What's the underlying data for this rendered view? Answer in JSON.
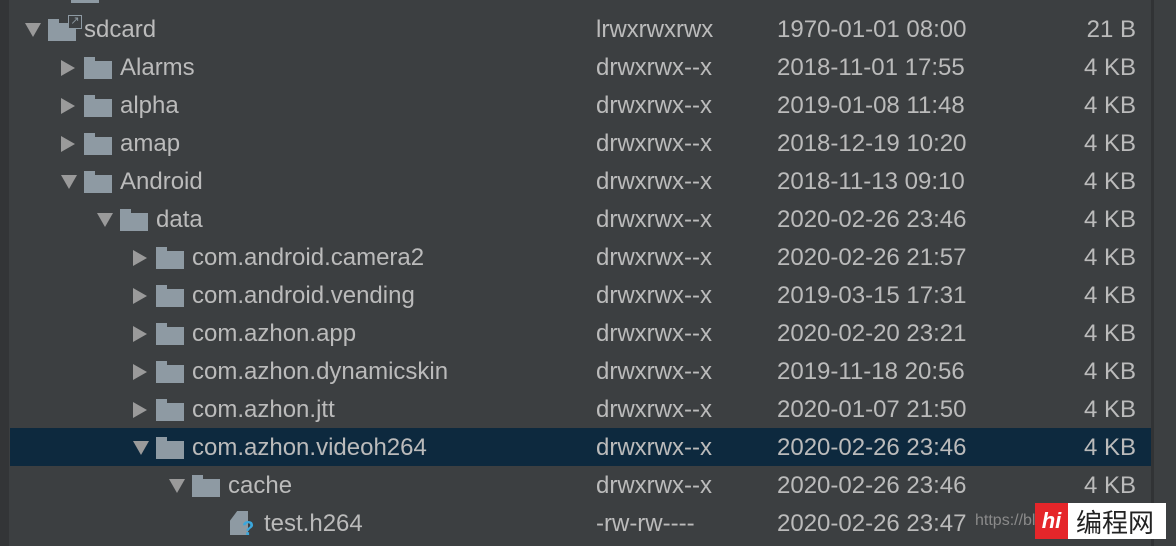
{
  "colors": {
    "background": "#3c3f41",
    "selected": "#0d293e",
    "text": "#bbbbbb",
    "folder": "#8e9aa3",
    "unknown_file": "#3ba7dc"
  },
  "rows": [
    {
      "name": "",
      "perm": "",
      "date": "",
      "size": "",
      "level": 0,
      "type": "folder",
      "arrow": "none"
    },
    {
      "name": "sdcard",
      "perm": "lrwxrwxrwx",
      "date": "1970-01-01 08:00",
      "size": "21 B",
      "level": 0,
      "type": "link",
      "arrow": "down"
    },
    {
      "name": "Alarms",
      "perm": "drwxrwx--x",
      "date": "2018-11-01 17:55",
      "size": "4 KB",
      "level": 1,
      "type": "folder",
      "arrow": "right"
    },
    {
      "name": "alpha",
      "perm": "drwxrwx--x",
      "date": "2019-01-08 11:48",
      "size": "4 KB",
      "level": 1,
      "type": "folder",
      "arrow": "right"
    },
    {
      "name": "amap",
      "perm": "drwxrwx--x",
      "date": "2018-12-19 10:20",
      "size": "4 KB",
      "level": 1,
      "type": "folder",
      "arrow": "right"
    },
    {
      "name": "Android",
      "perm": "drwxrwx--x",
      "date": "2018-11-13 09:10",
      "size": "4 KB",
      "level": 1,
      "type": "folder",
      "arrow": "down"
    },
    {
      "name": "data",
      "perm": "drwxrwx--x",
      "date": "2020-02-26 23:46",
      "size": "4 KB",
      "level": 2,
      "type": "folder",
      "arrow": "down"
    },
    {
      "name": "com.android.camera2",
      "perm": "drwxrwx--x",
      "date": "2020-02-26 21:57",
      "size": "4 KB",
      "level": 3,
      "type": "folder",
      "arrow": "right"
    },
    {
      "name": "com.android.vending",
      "perm": "drwxrwx--x",
      "date": "2019-03-15 17:31",
      "size": "4 KB",
      "level": 3,
      "type": "folder",
      "arrow": "right"
    },
    {
      "name": "com.azhon.app",
      "perm": "drwxrwx--x",
      "date": "2020-02-20 23:21",
      "size": "4 KB",
      "level": 3,
      "type": "folder",
      "arrow": "right"
    },
    {
      "name": "com.azhon.dynamicskin",
      "perm": "drwxrwx--x",
      "date": "2019-11-18 20:56",
      "size": "4 KB",
      "level": 3,
      "type": "folder",
      "arrow": "right"
    },
    {
      "name": "com.azhon.jtt",
      "perm": "drwxrwx--x",
      "date": "2020-01-07 21:50",
      "size": "4 KB",
      "level": 3,
      "type": "folder",
      "arrow": "right"
    },
    {
      "name": "com.azhon.videoh264",
      "perm": "drwxrwx--x",
      "date": "2020-02-26 23:46",
      "size": "4 KB",
      "level": 3,
      "type": "folder",
      "arrow": "down",
      "selected": true
    },
    {
      "name": "cache",
      "perm": "drwxrwx--x",
      "date": "2020-02-26 23:46",
      "size": "4 KB",
      "level": 4,
      "type": "folder",
      "arrow": "down"
    },
    {
      "name": "test.h264",
      "perm": "-rw-rw----",
      "date": "2020-02-26 23:47",
      "size": "",
      "level": 5,
      "type": "unknown-file",
      "arrow": "none"
    }
  ],
  "watermark": {
    "url": "https://blo",
    "logo_mark": "hi",
    "logo_text": "编程网"
  }
}
